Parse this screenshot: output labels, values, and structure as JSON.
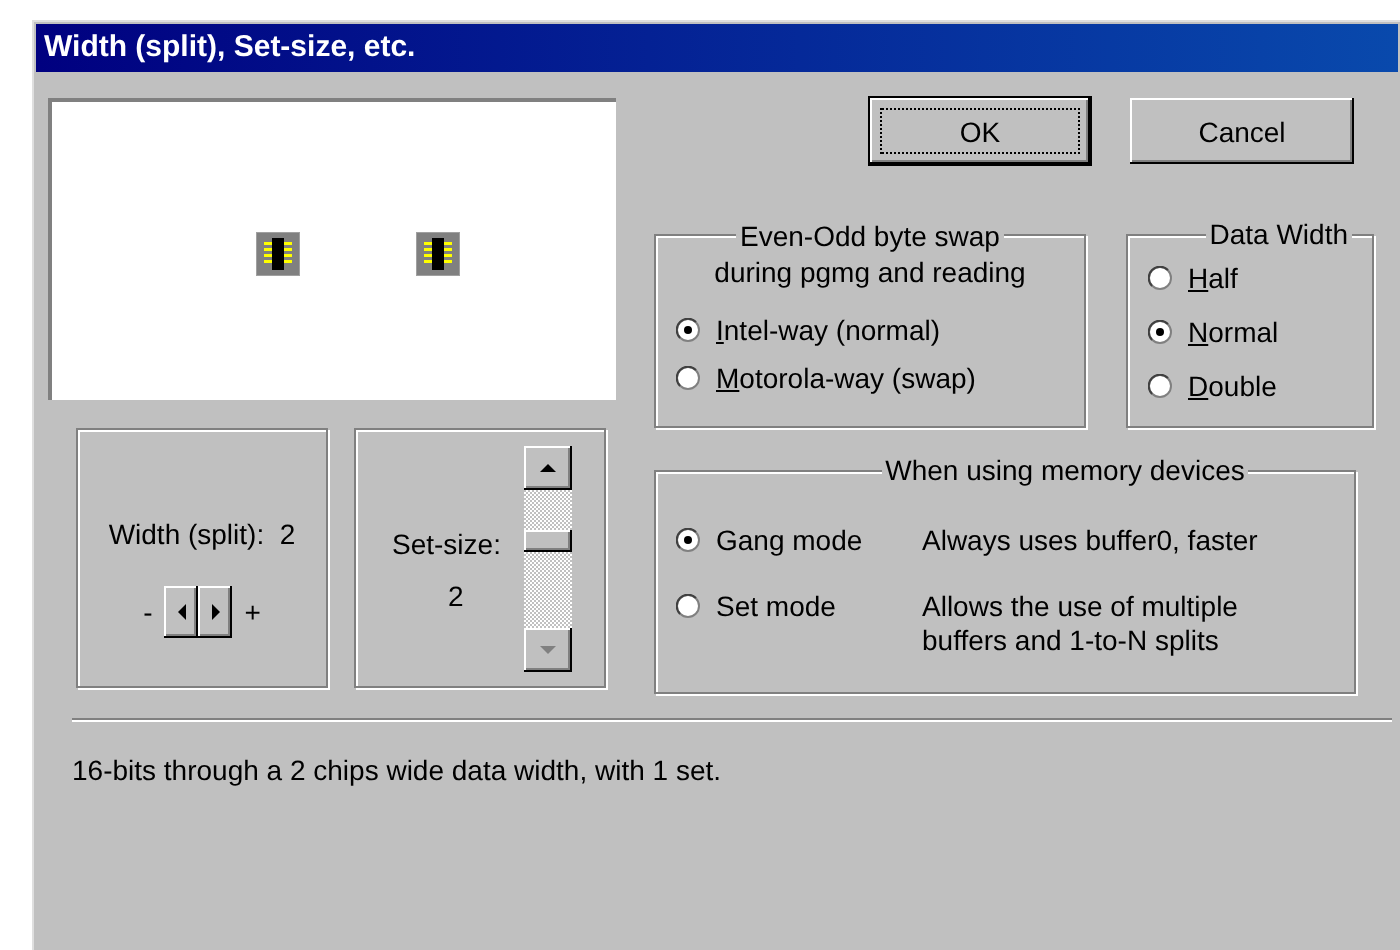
{
  "window": {
    "title": "Width (split), Set-size, etc."
  },
  "buttons": [
    {
      "label": "OK",
      "default": true
    },
    {
      "label": "Cancel",
      "default": false
    }
  ],
  "width_panel": {
    "label": "Width (split):",
    "value": "2",
    "minus": "-",
    "plus": "+"
  },
  "set_size_panel": {
    "label": "Set-size:",
    "value": "2"
  },
  "byte_swap": {
    "title_lines": [
      "Even-Odd byte swap",
      "during pgmg and reading"
    ],
    "options": [
      {
        "key": "I",
        "rest": "ntel-way (normal)",
        "selected": true
      },
      {
        "key": "M",
        "rest": "otorola-way (swap)",
        "selected": false
      }
    ]
  },
  "data_width": {
    "title": "Data Width",
    "options": [
      {
        "key": "H",
        "rest": "alf",
        "selected": false
      },
      {
        "key": "N",
        "rest": "ormal",
        "selected": true
      },
      {
        "key": "D",
        "rest": "ouble",
        "selected": false
      }
    ]
  },
  "memory_devices": {
    "title": "When using memory devices",
    "options": [
      {
        "label": "Gang mode",
        "description": "Always uses buffer0, faster",
        "selected": true
      },
      {
        "label": "Set mode",
        "description": "Allows the use of multiple buffers and 1-to-N splits",
        "selected": false
      }
    ]
  },
  "status": "16-bits through a 2 chips wide data width, with 1 set."
}
